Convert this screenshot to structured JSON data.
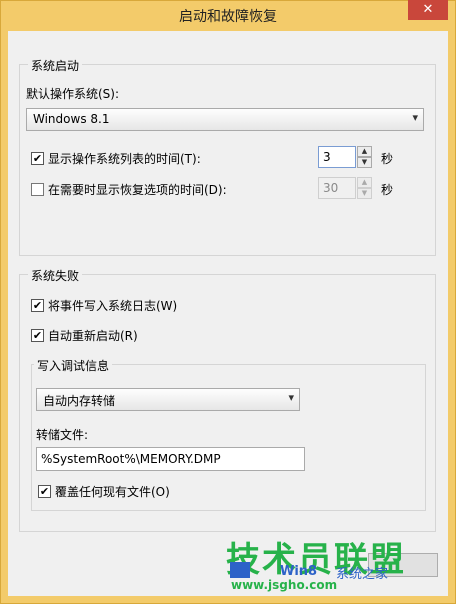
{
  "window": {
    "title": "启动和故障恢复",
    "close_label": "✕"
  },
  "startup": {
    "legend": "系统启动",
    "default_os_label": "默认操作系统(S):",
    "default_os_value": "Windows 8.1",
    "show_list": {
      "label": "显示操作系统列表的时间(T):",
      "checked": true,
      "value": "3",
      "unit": "秒"
    },
    "show_recovery": {
      "label": "在需要时显示恢复选项的时间(D):",
      "checked": false,
      "value": "30",
      "unit": "秒"
    }
  },
  "failure": {
    "legend": "系统失败",
    "write_event": {
      "label": "将事件写入系统日志(W)",
      "checked": true
    },
    "auto_restart": {
      "label": "自动重新启动(R)",
      "checked": true
    },
    "debug": {
      "legend": "写入调试信息",
      "type_value": "自动内存转储",
      "dump_file_label": "转储文件:",
      "dump_file_value": "%SystemRoot%\\MEMORY.DMP",
      "overwrite": {
        "label": "覆盖任何现有文件(O)",
        "checked": true
      }
    }
  },
  "watermark": {
    "main": "技术员联盟",
    "url": "www.jsgho.com",
    "win": "Win8",
    "win_suffix": "系统之家"
  },
  "icons": {
    "check": "✔",
    "dropdown": "chevron-down-icon",
    "spin": "spin-arrows-icon"
  }
}
